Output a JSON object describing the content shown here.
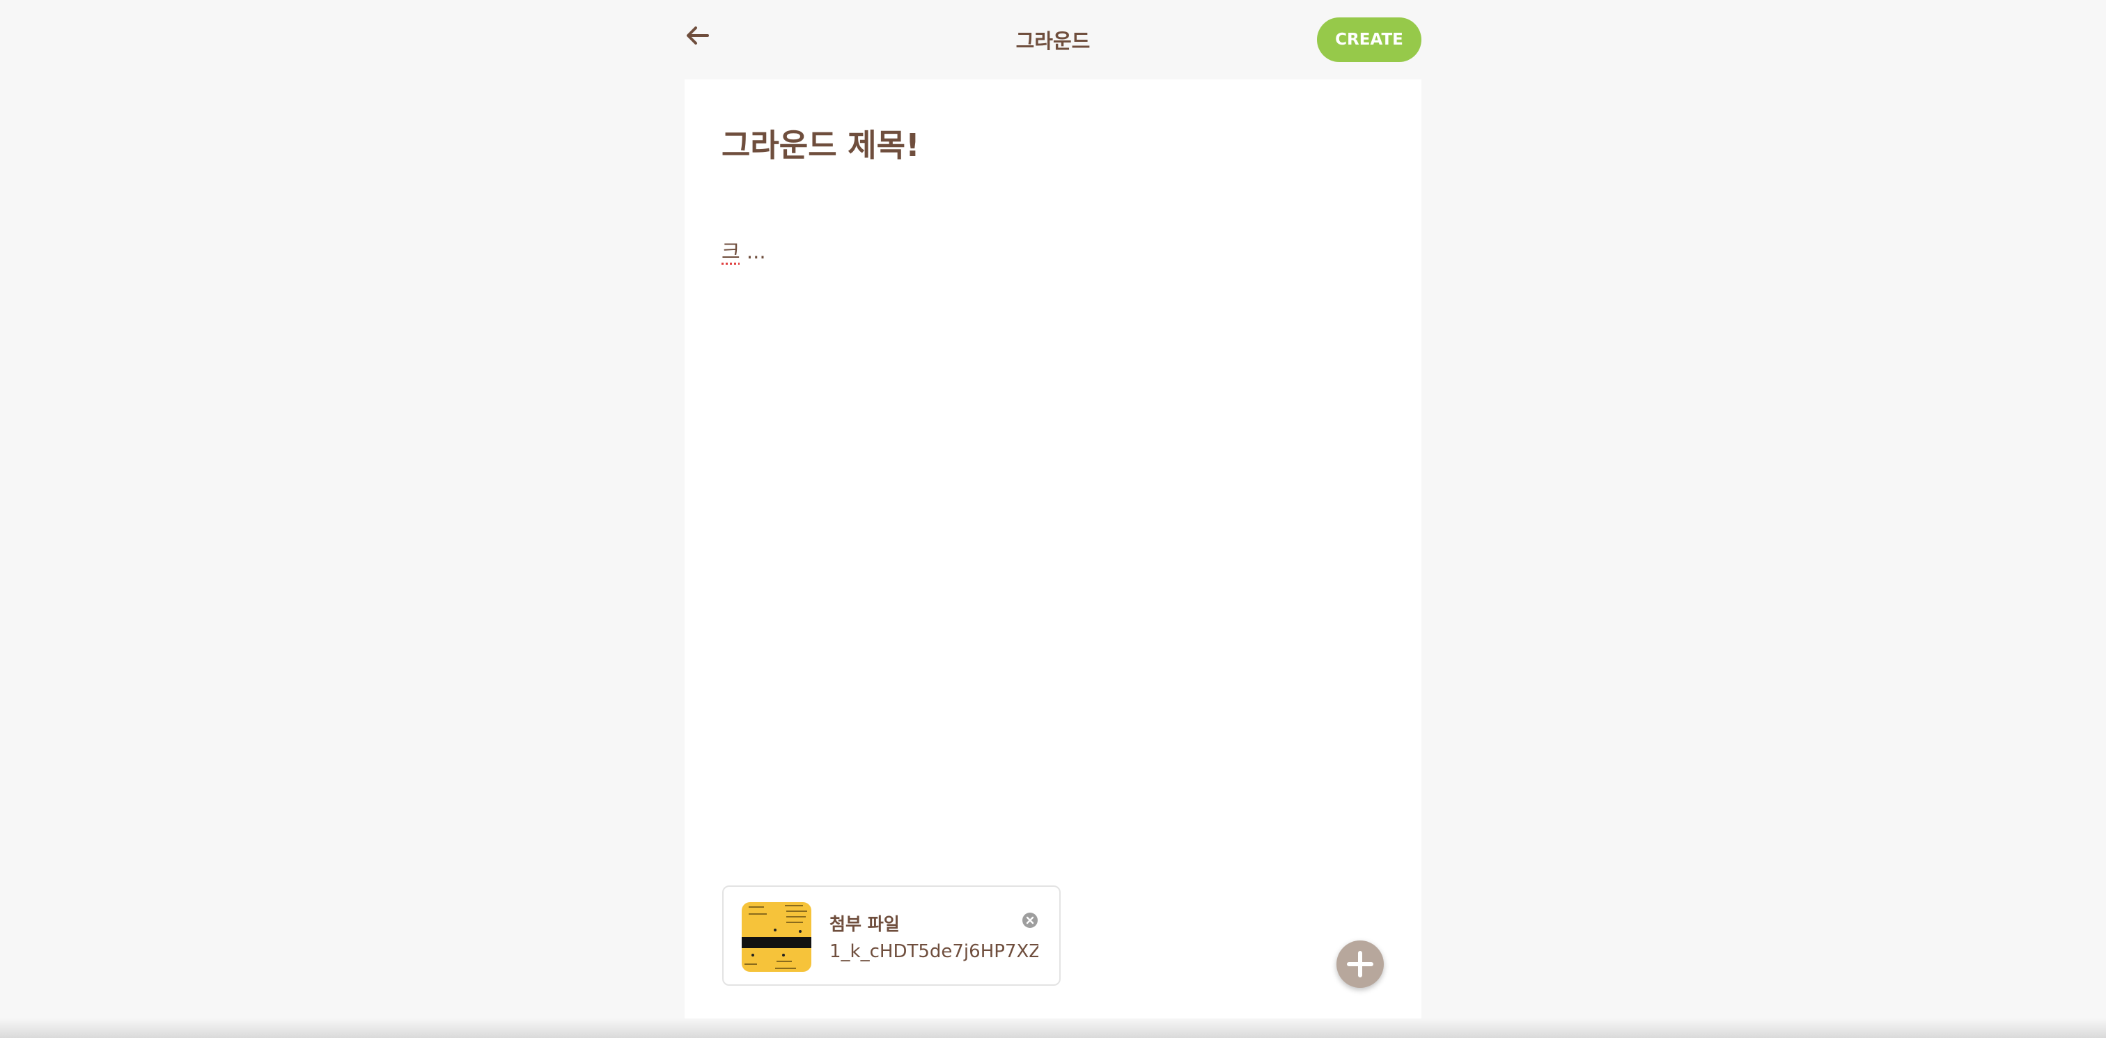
{
  "header": {
    "title": "그라운드",
    "back_icon": "arrow-left-icon",
    "create_label": "CREATE"
  },
  "post": {
    "title": "그라운드 제목!",
    "body_first": "크",
    "body_rest": " ..."
  },
  "attachment": {
    "label": "첨부 파일",
    "filename": "1_k_cHDT5de7j6HP7XZ...",
    "thumbnail": "image-thumbnail",
    "remove_icon": "close-circle-icon"
  },
  "fab": {
    "icon": "plus-icon"
  },
  "colors": {
    "brand_brown": "#6f4e3d",
    "accent_green": "#96c94a",
    "fab_gray": "#b7a79c",
    "background": "#f7f7f7",
    "card": "#ffffff"
  }
}
